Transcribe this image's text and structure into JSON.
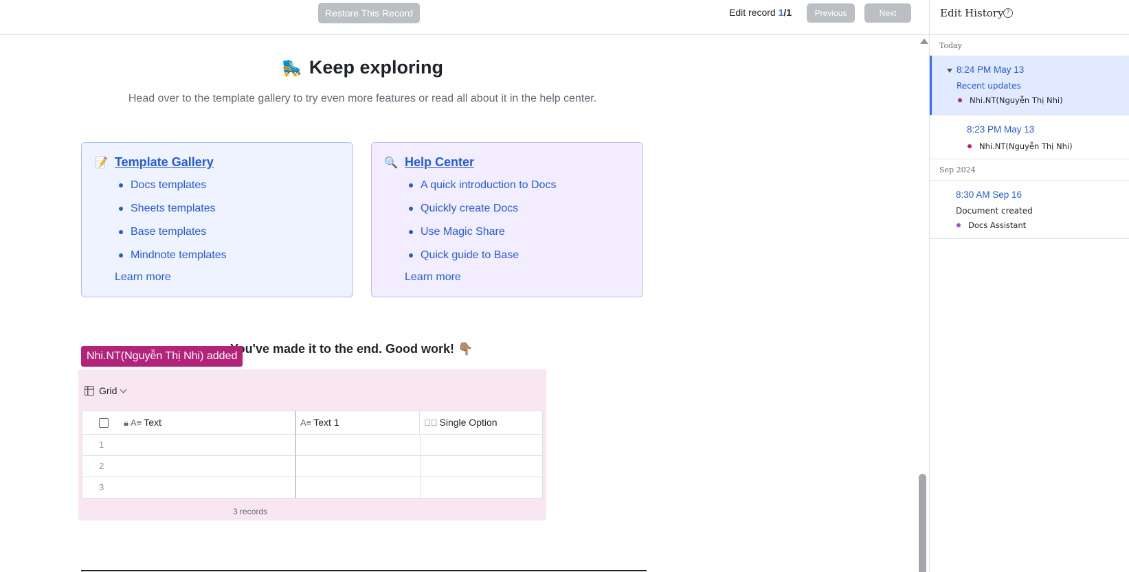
{
  "toolbar": {
    "restore_label": "Restore This Record",
    "edit_record_label": "Edit record",
    "current_record": "1",
    "separator": "/",
    "total_records": "1",
    "previous_label": "Previous",
    "next_label": "Next"
  },
  "doc": {
    "heading_emoji": "🛼",
    "heading": "Keep exploring",
    "subtext": "Head over to the template gallery to try even more features or read all about it in the help center.",
    "cards": [
      {
        "icon": "📝",
        "title": "Template Gallery",
        "items": [
          "Docs templates",
          "Sheets templates",
          "Base templates",
          "Mindnote templates"
        ],
        "learn_more": "Learn more"
      },
      {
        "icon": "🔍",
        "title": "Help Center",
        "items": [
          "A quick introduction to Docs",
          "Quickly create Docs",
          "Use Magic Share",
          "Quick guide to Base"
        ],
        "learn_more": "Learn more"
      }
    ],
    "end_text": "You've made it to the end. Good work! 👇🏽",
    "added_tag": "Nhi.NT(Nguyễn Thị Nhi) added",
    "base": {
      "view_label": "Grid",
      "columns": [
        "Text",
        "Text 1",
        "Single Option"
      ],
      "rows": [
        "1",
        "2",
        "3"
      ],
      "records_count": "3 records"
    }
  },
  "sidebar": {
    "title": "Edit History",
    "groups": [
      {
        "label": "Today",
        "entries": [
          {
            "time": "8:24 PM May 13",
            "note": "Recent updates",
            "user": "Nhi.NT(Nguyễn Thị Nhi)",
            "active": true
          },
          {
            "time": "8:23 PM May 13",
            "user": "Nhi.NT(Nguyễn Thị Nhi)"
          }
        ]
      },
      {
        "label": "Sep 2024",
        "entries": [
          {
            "time": "8:30 AM Sep 16",
            "note": "Document created",
            "user": "Docs Assistant"
          }
        ]
      }
    ]
  },
  "colors": {
    "accent": "#3370ff",
    "link": "#245bdb",
    "added_tag": "#b4237a",
    "base_highlight": "#f8e6f1",
    "disabled_button": "#bbbfc4",
    "user_dot_nhi": "#b4237a",
    "user_dot_assistant": "#9f4fd6"
  }
}
